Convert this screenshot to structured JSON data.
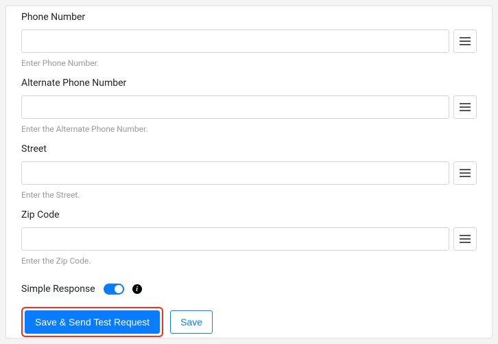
{
  "fields": [
    {
      "label": "Phone Number",
      "helper": "Enter Phone Number.",
      "value": ""
    },
    {
      "label": "Alternate Phone Number",
      "helper": "Enter the Alternate Phone Number.",
      "value": ""
    },
    {
      "label": "Street",
      "helper": "Enter the Street.",
      "value": ""
    },
    {
      "label": "Zip Code",
      "helper": "Enter the Zip Code.",
      "value": ""
    }
  ],
  "simple_response": {
    "label": "Simple Response",
    "enabled": true
  },
  "buttons": {
    "primary": "Save & Send Test Request",
    "secondary": "Save"
  }
}
